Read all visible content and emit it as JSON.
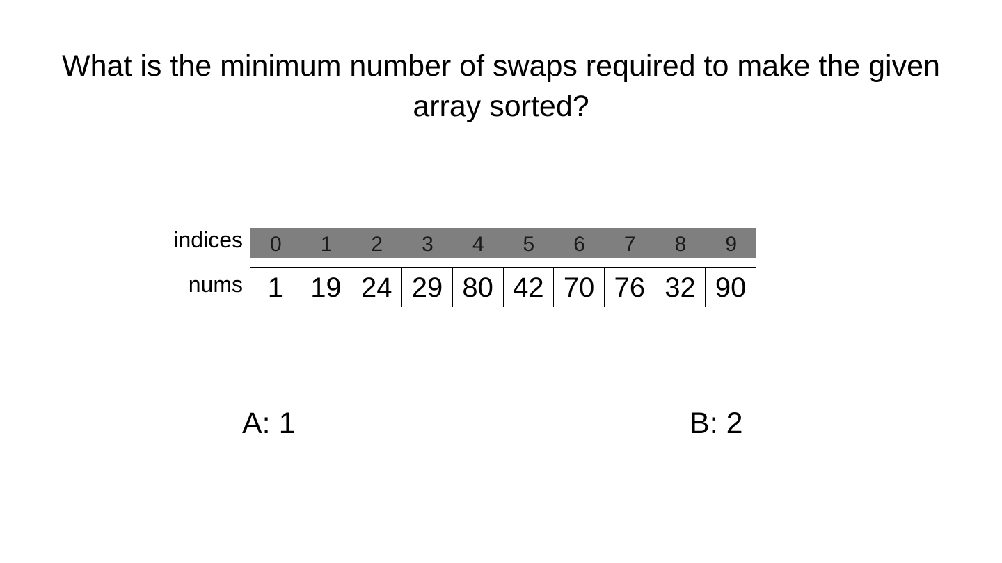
{
  "question": "What is the minimum number of swaps required to make the given array sorted?",
  "labels": {
    "indices": "indices",
    "nums": "nums"
  },
  "indices": [
    "0",
    "1",
    "2",
    "3",
    "4",
    "5",
    "6",
    "7",
    "8",
    "9"
  ],
  "nums": [
    "1",
    "19",
    "24",
    "29",
    "80",
    "42",
    "70",
    "76",
    "32",
    "90"
  ],
  "options": {
    "a": "A: 1",
    "b": "B: 2"
  },
  "colors": {
    "index_bar": "#7f7f7f",
    "background": "#ffffff",
    "text": "#000000"
  }
}
